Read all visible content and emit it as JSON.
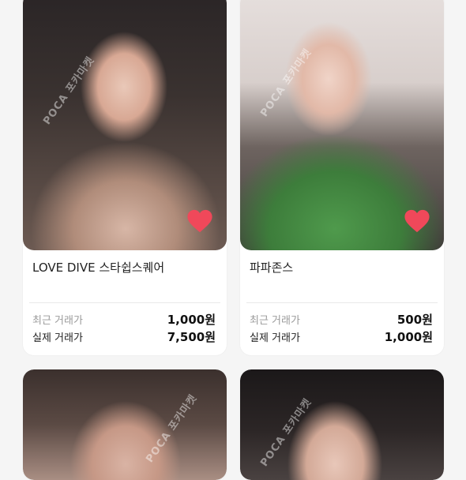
{
  "cards": [
    {
      "title": "LOVE DIVE 스타쉽스퀘어",
      "watermark": "POCA 포카마켓",
      "recent_label": "최근 거래가",
      "recent_price": "1,000원",
      "actual_label": "실제 거래가",
      "actual_price": "7,500원",
      "liked": true
    },
    {
      "title": "파파존스",
      "watermark": "POCA 포카마켓",
      "recent_label": "최근 거래가",
      "recent_price": "500원",
      "actual_label": "실제 거래가",
      "actual_price": "1,000원",
      "liked": true
    },
    {
      "watermark": "POCA 포카마켓"
    },
    {
      "watermark": "POCA 포카마켓"
    }
  ],
  "colors": {
    "heart": "#f0485a",
    "background": "#f5f5f5"
  },
  "icons": {
    "like": "heart-icon"
  }
}
